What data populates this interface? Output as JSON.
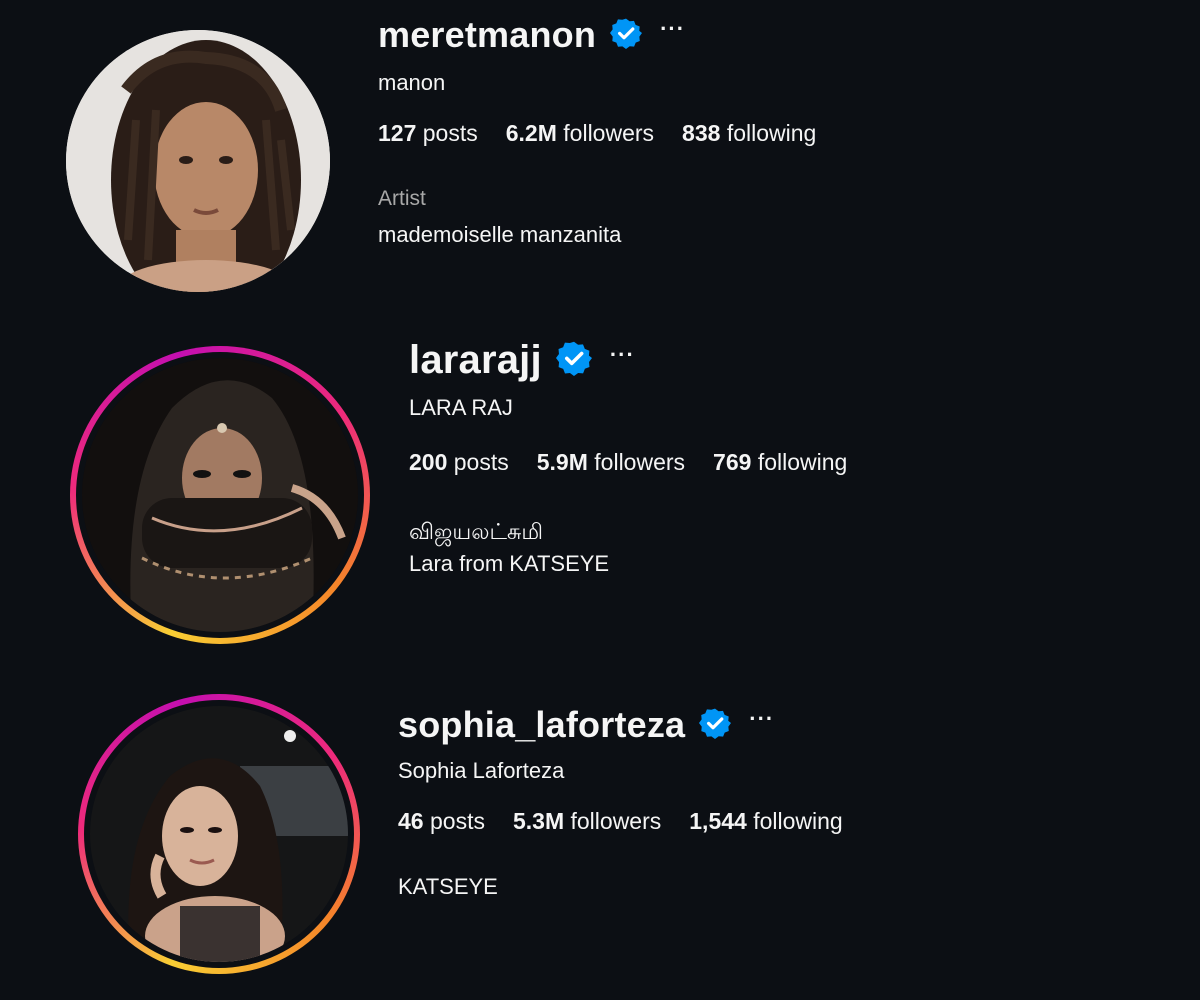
{
  "profiles": [
    {
      "username": "meretmanon",
      "full_name": "manon",
      "stats": {
        "posts": "127",
        "posts_label": "posts",
        "followers": "6.2M",
        "followers_label": "followers",
        "following": "838",
        "following_label": "following"
      },
      "category": "Artist",
      "bio_lines": [
        "mademoiselle manzanita"
      ],
      "more_label": "···"
    },
    {
      "username": "lararajj",
      "full_name": "LARA RAJ",
      "stats": {
        "posts": "200",
        "posts_label": "posts",
        "followers": "5.9M",
        "followers_label": "followers",
        "following": "769",
        "following_label": "following"
      },
      "bio_lines": [
        "விஜயலட்சுமி",
        "Lara from KATSEYE"
      ],
      "more_label": "···"
    },
    {
      "username": "sophia_laforteza",
      "full_name": "Sophia Laforteza",
      "stats": {
        "posts": "46",
        "posts_label": "posts",
        "followers": "5.3M",
        "followers_label": "followers",
        "following": "1,544",
        "following_label": "following"
      },
      "bio_lines": [
        "KATSEYE"
      ],
      "more_label": "···"
    }
  ],
  "colors": {
    "background": "#0c0f14",
    "verified": "#0095f6",
    "story_ring": [
      "#f9ce34",
      "#ee2a7b",
      "#c40fb0"
    ]
  },
  "icons": {
    "verified": "verified-badge-icon",
    "more": "more-options-icon"
  }
}
